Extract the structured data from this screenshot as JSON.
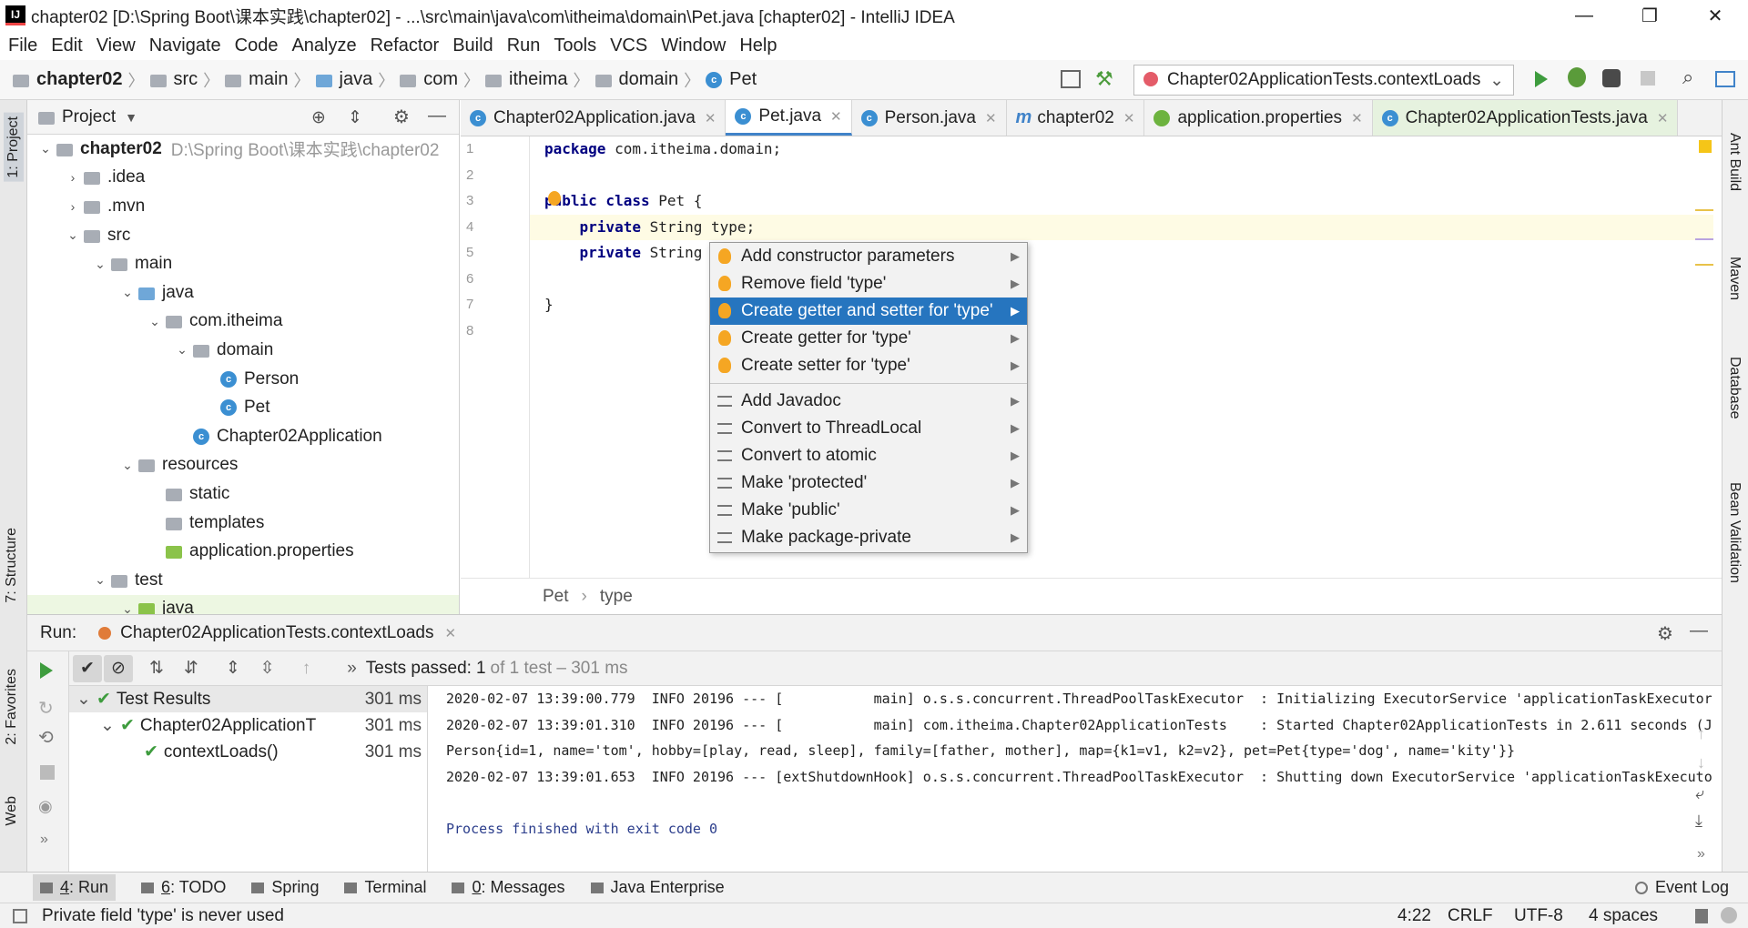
{
  "window": {
    "title": "chapter02 [D:\\Spring Boot\\课本实践\\chapter02] - ...\\src\\main\\java\\com\\itheima\\domain\\Pet.java [chapter02] - IntelliJ IDEA",
    "minimize": "—",
    "restore": "❐",
    "close": "✕"
  },
  "menu": [
    "File",
    "Edit",
    "View",
    "Navigate",
    "Code",
    "Analyze",
    "Refactor",
    "Build",
    "Run",
    "Tools",
    "VCS",
    "Window",
    "Help"
  ],
  "breadcrumbs": [
    "chapter02",
    "src",
    "main",
    "java",
    "com",
    "itheima",
    "domain",
    "Pet"
  ],
  "run_config": "Chapter02ApplicationTests.contextLoads",
  "project": {
    "header": "Project",
    "tree": [
      {
        "label": "chapter02",
        "extra": "D:\\Spring Boot\\课本实践\\chapter02",
        "arrow": "⌄",
        "level": 0,
        "icon": "module"
      },
      {
        "label": ".idea",
        "arrow": "›",
        "level": 1,
        "icon": "folder"
      },
      {
        "label": ".mvn",
        "arrow": "›",
        "level": 1,
        "icon": "folder"
      },
      {
        "label": "src",
        "arrow": "⌄",
        "level": 1,
        "icon": "folder"
      },
      {
        "label": "main",
        "arrow": "⌄",
        "level": 2,
        "icon": "folder"
      },
      {
        "label": "java",
        "arrow": "⌄",
        "level": 3,
        "icon": "folder-blue"
      },
      {
        "label": "com.itheima",
        "arrow": "⌄",
        "level": 4,
        "icon": "folder"
      },
      {
        "label": "domain",
        "arrow": "⌄",
        "level": 5,
        "icon": "folder"
      },
      {
        "label": "Person",
        "arrow": "",
        "level": 6,
        "icon": "class"
      },
      {
        "label": "Pet",
        "arrow": "",
        "level": 6,
        "icon": "class"
      },
      {
        "label": "Chapter02Application",
        "arrow": "",
        "level": 5,
        "icon": "class"
      },
      {
        "label": "resources",
        "arrow": "⌄",
        "level": 3,
        "icon": "folder"
      },
      {
        "label": "static",
        "arrow": "",
        "level": 4,
        "icon": "folder"
      },
      {
        "label": "templates",
        "arrow": "",
        "level": 4,
        "icon": "folder"
      },
      {
        "label": "application.properties",
        "arrow": "",
        "level": 4,
        "icon": "spring"
      },
      {
        "label": "test",
        "arrow": "⌄",
        "level": 2,
        "icon": "folder"
      },
      {
        "label": "java",
        "arrow": "⌄",
        "level": 3,
        "icon": "folder-green"
      }
    ]
  },
  "tabs": [
    {
      "label": "Chapter02Application.java",
      "icon": "C"
    },
    {
      "label": "Pet.java",
      "icon": "C",
      "active": true
    },
    {
      "label": "Person.java",
      "icon": "C"
    },
    {
      "label": "chapter02",
      "icon": "m"
    },
    {
      "label": "application.properties",
      "icon": "S"
    },
    {
      "label": "Chapter02ApplicationTests.java",
      "icon": "C",
      "green": true
    }
  ],
  "code": {
    "line_numbers": [
      "1",
      "2",
      "3",
      "4",
      "5",
      "6",
      "7",
      "8"
    ],
    "lines": [
      {
        "kw": "package",
        "rest": " com.itheima.domain;"
      },
      {
        "kw": "",
        "rest": ""
      },
      {
        "kw": "public class",
        "rest": " Pet {"
      },
      {
        "kw": "    private",
        "rest": " String type;"
      },
      {
        "kw": "    private",
        "rest": " String na"
      },
      {
        "kw": "",
        "rest": ""
      },
      {
        "kw": "",
        "rest": "}"
      },
      {
        "kw": "",
        "rest": ""
      }
    ]
  },
  "editor_breadcrumb": [
    "Pet",
    "type"
  ],
  "intentions": [
    {
      "label": "Add constructor parameters",
      "icon": "bulb"
    },
    {
      "label": "Remove field 'type'",
      "icon": "bulb"
    },
    {
      "label": "Create getter and setter for 'type'",
      "icon": "bulb",
      "selected": true
    },
    {
      "label": "Create getter for 'type'",
      "icon": "bulb"
    },
    {
      "label": "Create setter for 'type'",
      "icon": "bulb"
    },
    {
      "label": "Add Javadoc",
      "icon": "pencil",
      "sep": true
    },
    {
      "label": "Convert to ThreadLocal",
      "icon": "pencil"
    },
    {
      "label": "Convert to atomic",
      "icon": "pencil"
    },
    {
      "label": "Make 'protected'",
      "icon": "pencil"
    },
    {
      "label": "Make 'public'",
      "icon": "pencil"
    },
    {
      "label": "Make package-private",
      "icon": "pencil"
    }
  ],
  "run": {
    "label": "Run:",
    "tab": "Chapter02ApplicationTests.contextLoads",
    "status_prefix": "Tests passed:",
    "status_count": "1",
    "status_suffix": "of 1 test – 301 ms",
    "tests": [
      {
        "label": "Test Results",
        "time": "301 ms",
        "indent": 0,
        "arrow": "⌄"
      },
      {
        "label": "Chapter02ApplicationT",
        "time": "301 ms",
        "indent": 1,
        "arrow": "⌄"
      },
      {
        "label": "contextLoads()",
        "time": "301 ms",
        "indent": 2,
        "arrow": ""
      }
    ],
    "console": [
      "2020-02-07 13:39:00.779  INFO 20196 --- [           main] o.s.s.concurrent.ThreadPoolTaskExecutor  : Initializing ExecutorService 'applicationTaskExecutor'",
      "2020-02-07 13:39:01.310  INFO 20196 --- [           main] com.itheima.Chapter02ApplicationTests    : Started Chapter02ApplicationTests in 2.611 seconds (J",
      "Person{id=1, name='tom', hobby=[play, read, sleep], family=[father, mother], map={k1=v1, k2=v2}, pet=Pet{type='dog', name='kity'}}",
      "2020-02-07 13:39:01.653  INFO 20196 --- [extShutdownHook] o.s.s.concurrent.ThreadPoolTaskExecutor  : Shutting down ExecutorService 'applicationTaskExecuto",
      "",
      "Process finished with exit code 0"
    ]
  },
  "left_strip": [
    "1: Project",
    "7: Structure",
    "2: Favorites",
    "Web"
  ],
  "right_strip": [
    "Ant Build",
    "Maven",
    "Database",
    "Bean Validation"
  ],
  "bottom_tabs": [
    {
      "num": "4",
      "label": ": Run"
    },
    {
      "num": "6",
      "label": ": TODO"
    },
    {
      "num": "",
      "label": "Spring"
    },
    {
      "num": "",
      "label": "Terminal"
    },
    {
      "num": "0",
      "label": ": Messages"
    },
    {
      "num": "",
      "label": "Java Enterprise"
    }
  ],
  "event_log": "Event Log",
  "status": {
    "message": "Private field 'type' is never used",
    "position": "4:22",
    "line_sep": "CRLF",
    "encoding": "UTF-8",
    "indent": "4 spaces"
  },
  "colors": {
    "accent": "#2675bf",
    "pass": "#3e9c3e"
  }
}
